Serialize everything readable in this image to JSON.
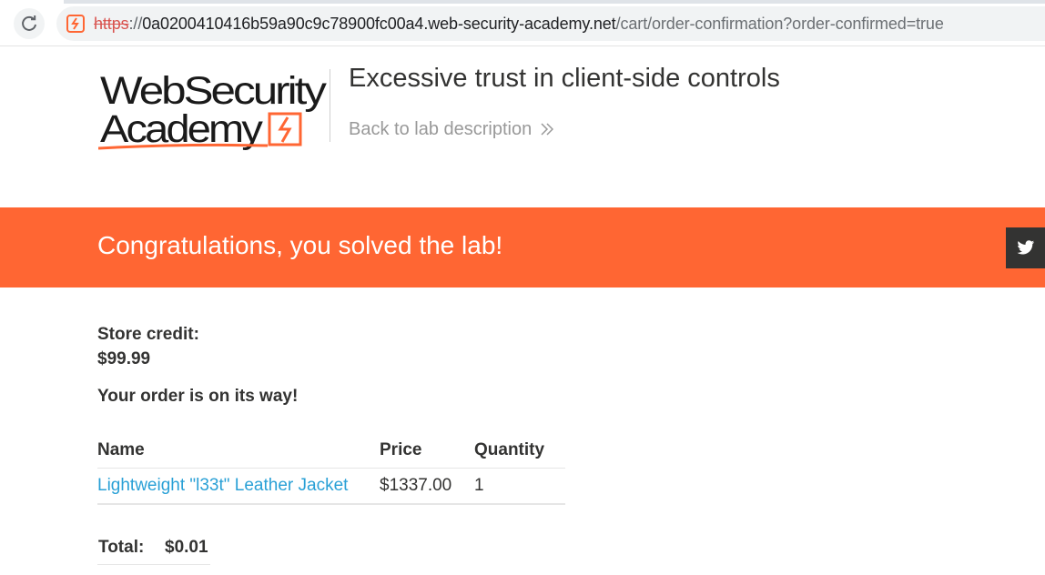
{
  "browser": {
    "url_scheme": "https",
    "url_separator": "://",
    "url_host": "0a0200410416b59a90c9c78900fc00a4.web-security-academy.net",
    "url_path": "/cart/order-confirmation?order-confirmed=true",
    "reload_icon": "reload-icon",
    "site_icon": "academy-favicon-icon"
  },
  "header": {
    "logo_line1": "WebSecurity",
    "logo_line2": "Academy",
    "lab_title": "Excessive trust in client-side controls",
    "back_link": "Back to lab description"
  },
  "banner": {
    "message": "Congratulations, you solved the lab!",
    "share_icon": "twitter-icon"
  },
  "store": {
    "credit_label": "Store credit:",
    "credit_value": "$99.99",
    "order_message": "Your order is on its way!"
  },
  "order_table": {
    "columns": [
      "Name",
      "Price",
      "Quantity"
    ],
    "rows": [
      {
        "name": "Lightweight \"l33t\" Leather Jacket",
        "price": "$1337.00",
        "quantity": "1"
      }
    ]
  },
  "total": {
    "label": "Total:",
    "value": "$0.01"
  },
  "colors": {
    "accent": "#ff6633",
    "link": "#29a0d6",
    "text": "#333332",
    "muted": "#999999"
  }
}
